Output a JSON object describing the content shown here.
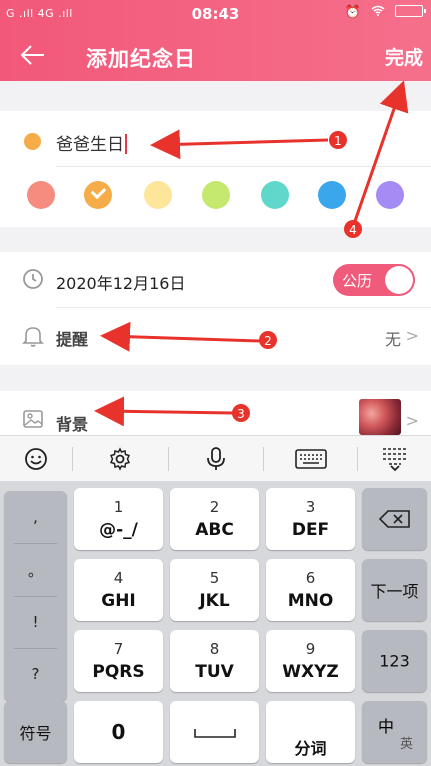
{
  "status_bar": {
    "left": "G .ıll 4G .ıll",
    "time": "08:43",
    "right_icons": [
      "alarm-icon",
      "wifi-icon",
      "battery-icon"
    ]
  },
  "header": {
    "title": "添加纪念日",
    "done_label": "完成"
  },
  "name": {
    "value": "爸爸生日",
    "dot_color": "#f6ac48"
  },
  "colors": {
    "swatches": [
      "#f58c7f",
      "#f6ac48",
      "#fde59a",
      "#c4e96e",
      "#5fd7cb",
      "#3aa6ec",
      "#a48cf4"
    ],
    "selected_index": 1
  },
  "date": {
    "value": "2020年12月16日",
    "calendar_toggle": "公历"
  },
  "remind": {
    "label": "提醒",
    "value": "无"
  },
  "background": {
    "label": "背景"
  },
  "annotations": [
    "1",
    "2",
    "3",
    "4"
  ],
  "keyboard": {
    "toolbar": [
      "emoji-icon",
      "settings-icon",
      "mic-icon",
      "keyboard-icon",
      "collapse-icon"
    ],
    "punctuation": [
      ",",
      "。",
      "!",
      "?"
    ],
    "keys": [
      {
        "num": "1",
        "letters": "@-_/"
      },
      {
        "num": "2",
        "letters": "ABC"
      },
      {
        "num": "3",
        "letters": "DEF"
      },
      {
        "num": "4",
        "letters": "GHI"
      },
      {
        "num": "5",
        "letters": "JKL"
      },
      {
        "num": "6",
        "letters": "MNO"
      },
      {
        "num": "7",
        "letters": "PQRS"
      },
      {
        "num": "8",
        "letters": "TUV"
      },
      {
        "num": "9",
        "letters": "WXYZ"
      }
    ],
    "next_label": "下一项",
    "num_label": "123",
    "symbol_label": "符号",
    "zero_label": "0",
    "split_label": "分词",
    "lang_label": "中",
    "lang_sub": "英"
  }
}
